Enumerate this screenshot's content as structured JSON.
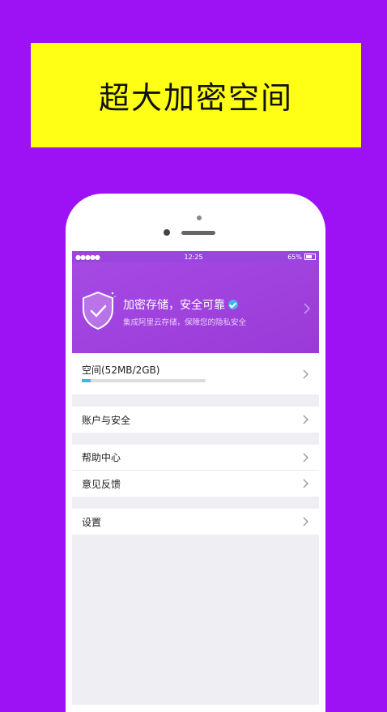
{
  "banner": {
    "title": "超大加密空间"
  },
  "status_bar": {
    "signal": "●●●●●",
    "time": "12:25",
    "battery": "65%"
  },
  "header": {
    "title": "加密存储，安全可靠",
    "subtitle": "集成阿里云存储，保障您的隐私安全"
  },
  "storage": {
    "label": "空间(52MB/2GB)",
    "progress_fraction": 0.07
  },
  "menu": {
    "account": "账户与安全",
    "help": "帮助中心",
    "feedback": "意见反馈",
    "settings": "设置"
  },
  "colors": {
    "background": "#9c12f4",
    "banner": "#ffff16",
    "header": "#9a3ad8",
    "accent": "#3fb6ea"
  }
}
